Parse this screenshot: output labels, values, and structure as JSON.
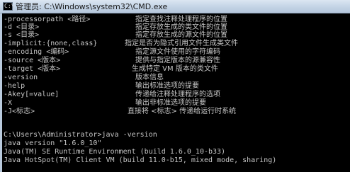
{
  "window": {
    "title": "管理员: C:\\Windows\\system32\\CMD.exe",
    "icon": "cmd-icon",
    "icon_glyph": "C:\\"
  },
  "console": {
    "options": [
      {
        "flag": "-processorpath <路径>",
        "desc": "指定查找注释处理程序的位置"
      },
      {
        "flag": "-d <目录>",
        "desc": "指定存放生成的类文件的位置"
      },
      {
        "flag": "-s <目录>",
        "desc": "指定存放生成的源文件的位置"
      },
      {
        "flag": "-implicit:{none,class}",
        "desc": "指定是否为隐式引用文件生成类文件"
      },
      {
        "flag": "-encoding <编码>",
        "desc": "指定源文件使用的字符编码"
      },
      {
        "flag": "-source <版本>",
        "desc": "提供与指定版本的源兼容性"
      },
      {
        "flag": "-target <版本>",
        "desc": "生成特定 VM 版本的类文件"
      },
      {
        "flag": "-version",
        "desc": "版本信息"
      },
      {
        "flag": "-help",
        "desc": "输出标准选项的提要"
      },
      {
        "flag": "-Akey[=value]",
        "desc": "传递给注释处理程序的选项"
      },
      {
        "flag": "-X",
        "desc": "输出非标准选项的提要"
      },
      {
        "flag": "-J<标志>",
        "desc": "直接将 <标志> 传递给运行时系统"
      }
    ],
    "prompt_command": "C:\\Users\\Administrator>java -version",
    "output": [
      "java version \"1.6.0_10\"",
      "Java(TM) SE Runtime Environment (build 1.6.0_10-b33)",
      "Java HotSpot(TM) Client VM (build 11.0-b15, mixed mode, sharing)"
    ]
  }
}
